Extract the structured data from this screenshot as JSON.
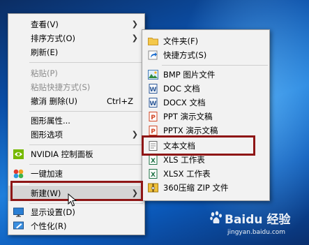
{
  "main_menu": {
    "items": [
      {
        "label": "查看(V)",
        "has_submenu": true
      },
      {
        "label": "排序方式(O)",
        "has_submenu": true
      },
      {
        "label": "刷新(E)"
      },
      {
        "label": "粘贴(P)",
        "disabled": true
      },
      {
        "label": "粘贴快捷方式(S)",
        "disabled": true
      },
      {
        "label": "撤消 删除(U)",
        "shortcut": "Ctrl+Z"
      },
      {
        "label": "图形属性..."
      },
      {
        "label": "图形选项",
        "has_submenu": true
      },
      {
        "label": "NVIDIA 控制面板",
        "icon": "nvidia-icon"
      },
      {
        "label": "一键加速",
        "icon": "accelerate-icon"
      },
      {
        "label": "新建(W)",
        "has_submenu": true,
        "selected": true
      },
      {
        "label": "显示设置(D)",
        "icon": "display-settings-icon"
      },
      {
        "label": "个性化(R)",
        "icon": "personalize-icon"
      }
    ]
  },
  "new_submenu": {
    "items": [
      {
        "label": "文件夹(F)",
        "icon": "folder-icon"
      },
      {
        "label": "快捷方式(S)",
        "icon": "shortcut-icon"
      },
      {
        "label": "BMP 图片文件",
        "icon": "bmp-file-icon"
      },
      {
        "label": "DOC 文档",
        "icon": "doc-file-icon"
      },
      {
        "label": "DOCX 文档",
        "icon": "docx-file-icon"
      },
      {
        "label": "PPT 演示文稿",
        "icon": "ppt-file-icon"
      },
      {
        "label": "PPTX 演示文稿",
        "icon": "pptx-file-icon"
      },
      {
        "label": "文本文档",
        "icon": "text-file-icon",
        "highlighted": true
      },
      {
        "label": "XLS 工作表",
        "icon": "xls-file-icon"
      },
      {
        "label": "XLSX 工作表",
        "icon": "xlsx-file-icon"
      },
      {
        "label": "360压缩 ZIP 文件",
        "icon": "zip-file-icon"
      }
    ]
  },
  "watermark": {
    "brand": "Baidu 经验",
    "url": "jingyan.baidu.com"
  },
  "colors": {
    "highlight_box": "#8e1616",
    "menu_bg": "#f2f2f2",
    "selected_bg": "#d5d5d5"
  }
}
